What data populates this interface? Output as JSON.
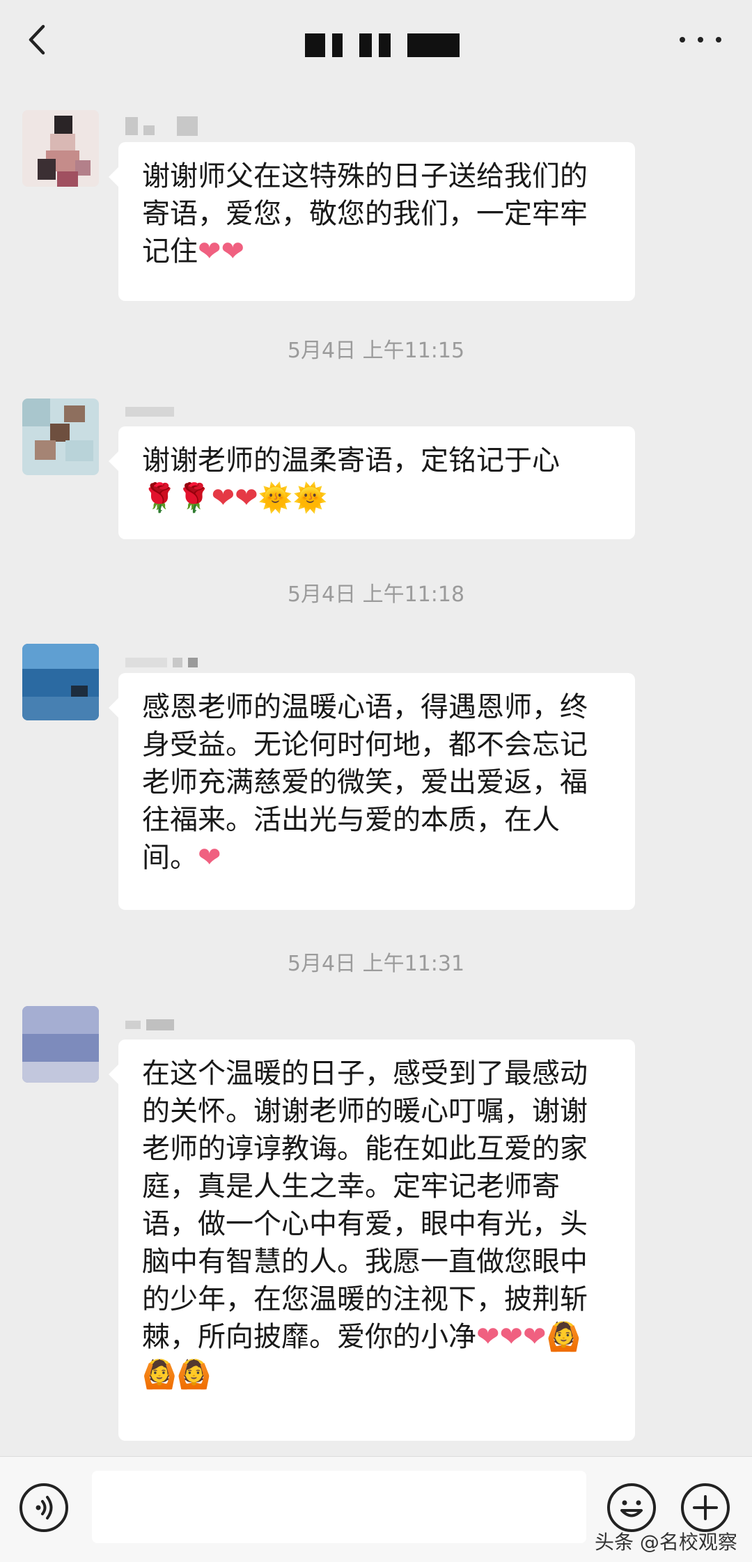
{
  "header": {
    "title": ""
  },
  "messages": [
    {
      "text": "谢谢师父在这特殊的日子送给我们的寄语，爱您，敬您的我们，一定牢牢记住",
      "emojis": "❤❤"
    },
    {
      "text": "谢谢老师的温柔寄语，定铭记于心",
      "emojis": "🌹🌹❤❤🌞🌞"
    },
    {
      "text": "感恩老师的温暖心语，得遇恩师，终身受益。无论何时何地，都不会忘记老师充满慈爱的微笑，爱出爱返，福往福来。活出光与爱的本质，在人间。",
      "emojis": "❤"
    },
    {
      "text": "在这个温暖的日子，感受到了最感动的关怀。谢谢老师的暖心叮嘱，谢谢老师的谆谆教诲。能在如此互爱的家庭，真是人生之幸。定牢记老师寄语，做一个心中有爱，眼中有光，头脑中有智慧的人。我愿一直做您眼中的少年，在您温暖的注视下，披荆斩棘，所向披靡。爱你的小净",
      "emojis": "❤❤❤🙆🙆🙆"
    }
  ],
  "timestamps": [
    "5月4日 上午11:15",
    "5月4日 上午11:18",
    "5月4日 上午11:31"
  ],
  "watermark": "头条 @名校观察",
  "colors": {
    "background": "#ededed",
    "bubble": "#ffffff",
    "timestamp": "#9b9b9b"
  }
}
